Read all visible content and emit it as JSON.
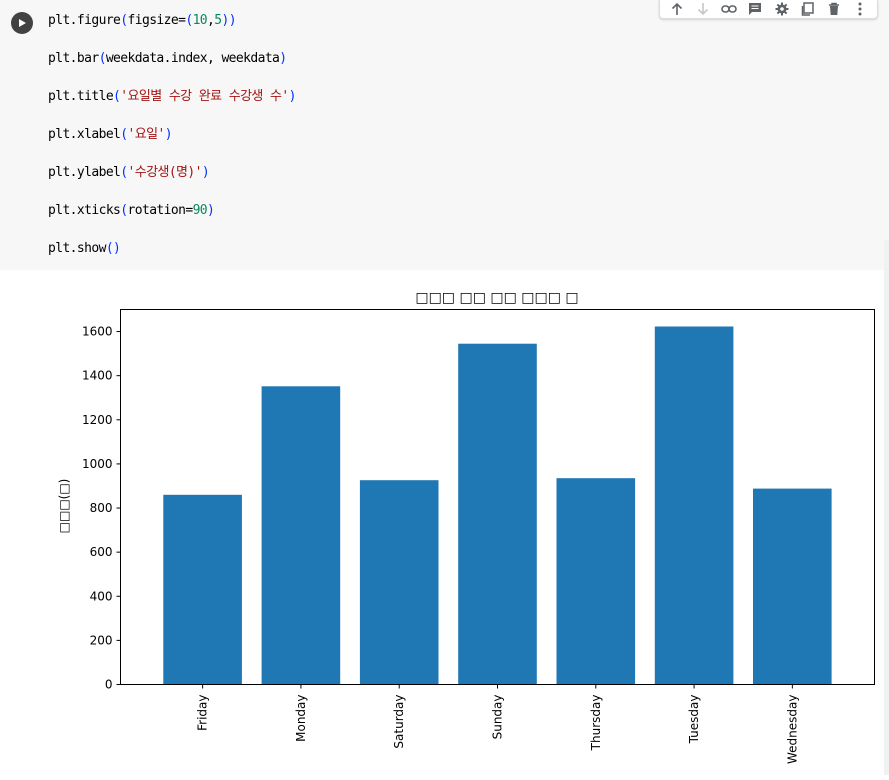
{
  "cell": {
    "code_lines": [
      [
        {
          "t": "plt.figure",
          "c": "plain"
        },
        {
          "t": "(",
          "c": "paren"
        },
        {
          "t": "figsize=",
          "c": "plain"
        },
        {
          "t": "(",
          "c": "paren"
        },
        {
          "t": "10",
          "c": "num"
        },
        {
          "t": ",",
          "c": "plain"
        },
        {
          "t": "5",
          "c": "num"
        },
        {
          "t": "))",
          "c": "paren"
        }
      ],
      [
        {
          "t": "plt.bar",
          "c": "plain"
        },
        {
          "t": "(",
          "c": "paren"
        },
        {
          "t": "weekdata.index, weekdata",
          "c": "plain"
        },
        {
          "t": ")",
          "c": "paren"
        }
      ],
      [
        {
          "t": "plt.title",
          "c": "plain"
        },
        {
          "t": "(",
          "c": "paren"
        },
        {
          "t": "'요일별 수강 완료 수강생 수'",
          "c": "str"
        },
        {
          "t": ")",
          "c": "paren"
        }
      ],
      [
        {
          "t": "plt.xlabel",
          "c": "plain"
        },
        {
          "t": "(",
          "c": "paren"
        },
        {
          "t": "'요일'",
          "c": "str"
        },
        {
          "t": ")",
          "c": "paren"
        }
      ],
      [
        {
          "t": "plt.ylabel",
          "c": "plain"
        },
        {
          "t": "(",
          "c": "paren"
        },
        {
          "t": "'수강생(명)'",
          "c": "str"
        },
        {
          "t": ")",
          "c": "paren"
        }
      ],
      [
        {
          "t": "plt.xticks",
          "c": "plain"
        },
        {
          "t": "(",
          "c": "paren"
        },
        {
          "t": "rotation=",
          "c": "plain"
        },
        {
          "t": "90",
          "c": "num"
        },
        {
          "t": ")",
          "c": "paren"
        }
      ],
      [
        {
          "t": "plt.show",
          "c": "plain"
        },
        {
          "t": "()",
          "c": "paren"
        }
      ]
    ],
    "toolbar_icons": [
      "arrow-up-icon",
      "arrow-down-icon",
      "link-icon",
      "comment-icon",
      "gear-icon",
      "mirror-cell-icon",
      "trash-icon",
      "more-vert-icon"
    ]
  },
  "colors": {
    "paren": "#0431fa",
    "num": "#09885a",
    "str": "#a31515",
    "bar": "#1f77b4"
  },
  "chart_data": {
    "type": "bar",
    "title": "□□□ □□ □□ □□□ □",
    "xlabel": "",
    "ylabel": "□□□(□)",
    "categories": [
      "Friday",
      "Monday",
      "Saturday",
      "Sunday",
      "Thursday",
      "Tuesday",
      "Wednesday"
    ],
    "values": [
      860,
      1352,
      926,
      1545,
      935,
      1623,
      888
    ],
    "ylim": [
      0,
      1700
    ],
    "yticks": [
      0,
      200,
      400,
      600,
      800,
      1000,
      1200,
      1400,
      1600
    ],
    "xtick_rotation": 90,
    "grid": false
  }
}
